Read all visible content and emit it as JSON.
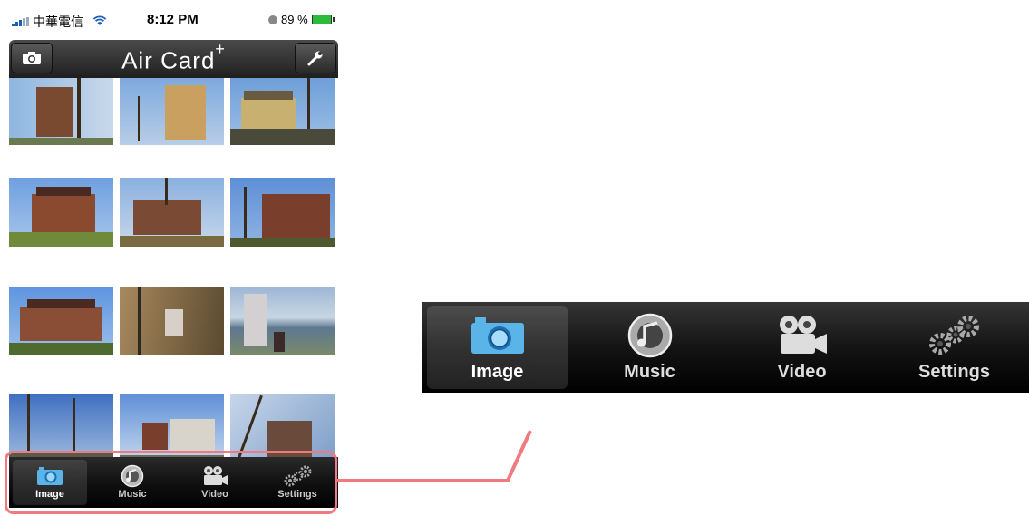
{
  "status_bar": {
    "carrier": "中華電信",
    "time": "8:12 PM",
    "battery": "89 %"
  },
  "nav_bar": {
    "title": "Air Card",
    "title_sup": "+",
    "left_icon": "camera-icon",
    "right_icon": "wrench-icon"
  },
  "photos": {
    "rows": 4,
    "columns": 3
  },
  "tab_bar": {
    "selected": "Image",
    "items": [
      {
        "label": "Image",
        "icon": "camera-icon"
      },
      {
        "label": "Music",
        "icon": "music-disc-icon"
      },
      {
        "label": "Video",
        "icon": "film-camera-icon"
      },
      {
        "label": "Settings",
        "icon": "gears-icon"
      }
    ]
  },
  "zoomed_tab_bar": {
    "items": [
      {
        "label": "Image",
        "icon": "camera-icon"
      },
      {
        "label": "Music",
        "icon": "music-disc-icon"
      },
      {
        "label": "Video",
        "icon": "film-camera-icon"
      },
      {
        "label": "Settings",
        "icon": "gears-icon"
      }
    ]
  },
  "colors": {
    "highlight": "#f07a80",
    "selected_icon": "#5ab4e8",
    "tab_bar_bg": "#111111"
  }
}
